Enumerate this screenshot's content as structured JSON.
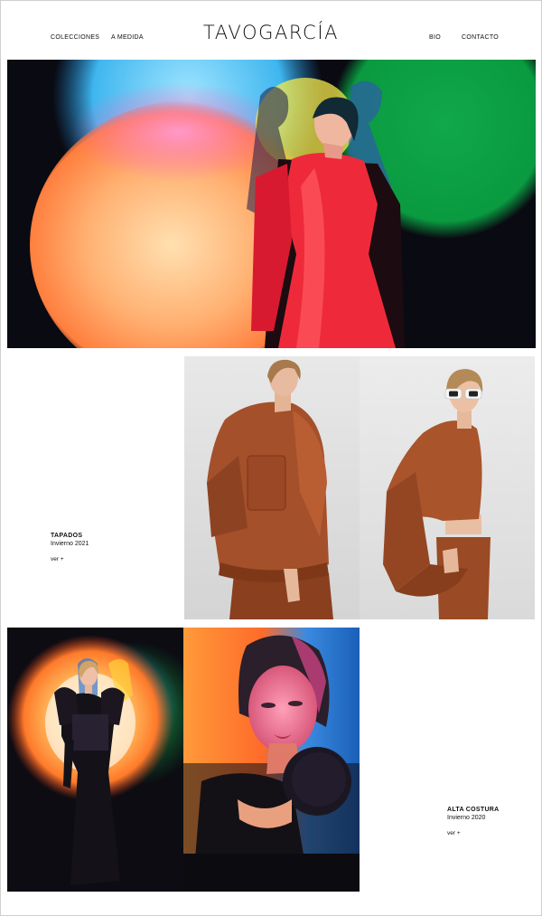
{
  "header": {
    "logo": "TAVOGARCÍA",
    "nav_left": [
      "COLECCIONES",
      "A MEDIDA"
    ],
    "nav_right": [
      "BIO",
      "CONTACTO"
    ]
  },
  "hero": {
    "image": "model-red-dress-colored-lights"
  },
  "collections": [
    {
      "title": "TAPADOS",
      "season": "Invierno 2021",
      "more": "ver +",
      "images": [
        "model-rust-jacket-looking-down",
        "model-rust-jacket-white-sunglasses"
      ]
    },
    {
      "title": "ALTA COSTURA",
      "season": "Invierno 2020",
      "more": "ver +",
      "images": [
        "model-black-gown-colored-spotlight",
        "model-closeup-puff-sleeve"
      ]
    }
  ],
  "colors": {
    "text": "#111111",
    "border": "#cfcfcf",
    "background": "#ffffff"
  }
}
